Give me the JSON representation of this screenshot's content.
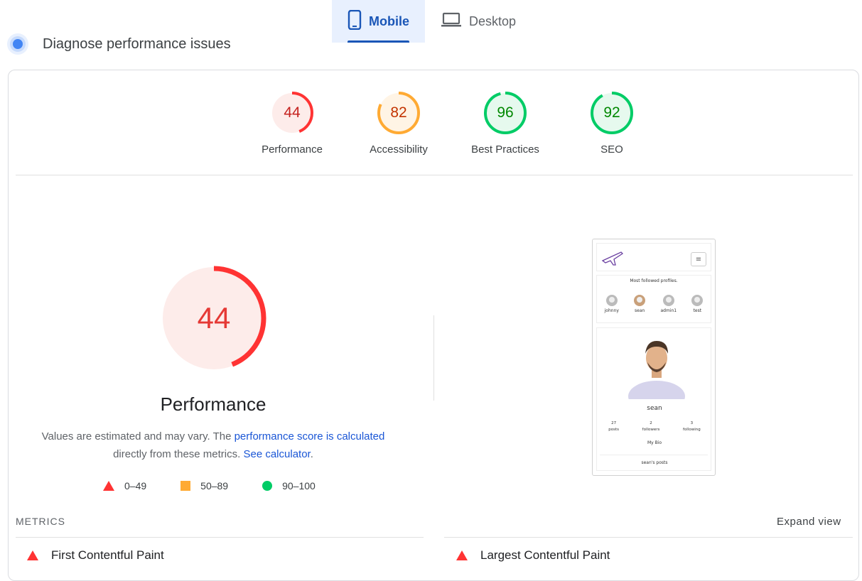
{
  "tabs": [
    {
      "label": "Mobile",
      "icon": "smartphone-icon",
      "active": true
    },
    {
      "label": "Desktop",
      "icon": "laptop-icon",
      "active": false
    }
  ],
  "diagnose": {
    "title": "Diagnose performance issues"
  },
  "scores": [
    {
      "label": "Performance",
      "value": 44,
      "color": "#f33",
      "bg": "#fdecea",
      "text_color": "#c5221f"
    },
    {
      "label": "Accessibility",
      "value": 82,
      "color": "#fa3",
      "bg": "#fff4e5",
      "text_color": "#c33300"
    },
    {
      "label": "Best Practices",
      "value": 96,
      "color": "#0c6",
      "bg": "#e6f9ee",
      "text_color": "#080"
    },
    {
      "label": "SEO",
      "value": 92,
      "color": "#0c6",
      "bg": "#e6f9ee",
      "text_color": "#080"
    }
  ],
  "performance": {
    "score": "44",
    "title": "Performance",
    "desc_prefix": "Values are estimated and may vary. The ",
    "desc_link1": "performance score is calculated",
    "desc_mid": "directly from these metrics. ",
    "desc_link2": "See calculator",
    "desc_suffix": "."
  },
  "legend": [
    {
      "range": "0–49",
      "shape": "triangle",
      "color": "#f33"
    },
    {
      "range": "50–89",
      "shape": "square",
      "color": "#fa3"
    },
    {
      "range": "90–100",
      "shape": "circle",
      "color": "#0c6"
    }
  ],
  "screenshot": {
    "most_followed": "Most followed profiles.",
    "profiles": [
      "johnny",
      "sean",
      "admin1",
      "test"
    ],
    "name": "sean",
    "stats": [
      {
        "num": "27",
        "label": "posts"
      },
      {
        "num": "2",
        "label": "followers"
      },
      {
        "num": "3",
        "label": "following"
      }
    ],
    "bio": "My Bio",
    "posts": "sean's posts"
  },
  "metrics": {
    "label": "METRICS",
    "expand": "Expand view",
    "items": [
      "First Contentful Paint",
      "Largest Contentful Paint"
    ]
  }
}
